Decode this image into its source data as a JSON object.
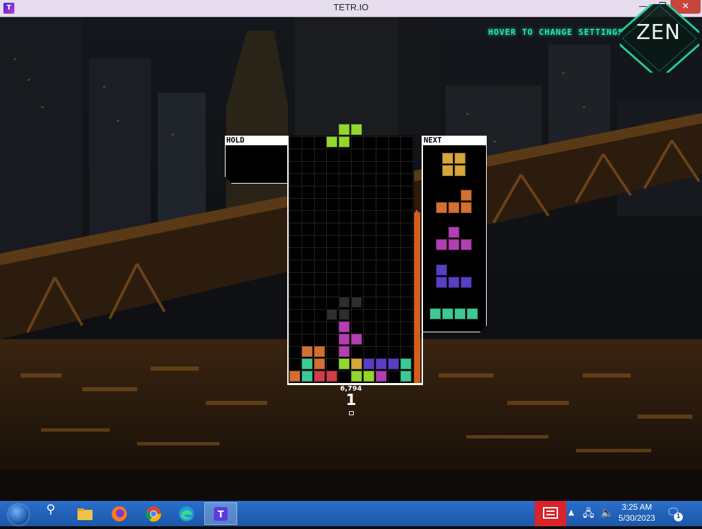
{
  "window": {
    "title": "TETR.IO",
    "app_icon_text": "T",
    "buttons": {
      "minimize": "—",
      "maximize": "❐",
      "close": "✕"
    }
  },
  "game": {
    "hover_settings": "HOVER TO CHANGE SETTINGS",
    "mode": "ZEN",
    "hold_label": "HOLD",
    "next_label": "NEXT",
    "score": "6,794",
    "lines": "1",
    "colors": {
      "S": "#93d62e",
      "O": "#d6a63a",
      "L": "#d46f32",
      "T": "#b13fb0",
      "J": "#5a3ec4",
      "I": "#3ec896",
      "Z": "#d23c48",
      "accent": "#29e0b0",
      "garbage": "#d45f1a"
    },
    "next_queue": [
      "O",
      "L",
      "T",
      "J",
      "I"
    ],
    "active_piece": "S",
    "ghost_piece": "S"
  },
  "taskbar": {
    "items": [
      "start",
      "search-icon",
      "file-explorer-icon",
      "firefox-icon",
      "chrome-icon",
      "edge-icon",
      "tetrio-icon"
    ],
    "search_glyph": "⚲",
    "time": "3:25 AM",
    "date": "5/30/2023",
    "notification_count": "1"
  }
}
